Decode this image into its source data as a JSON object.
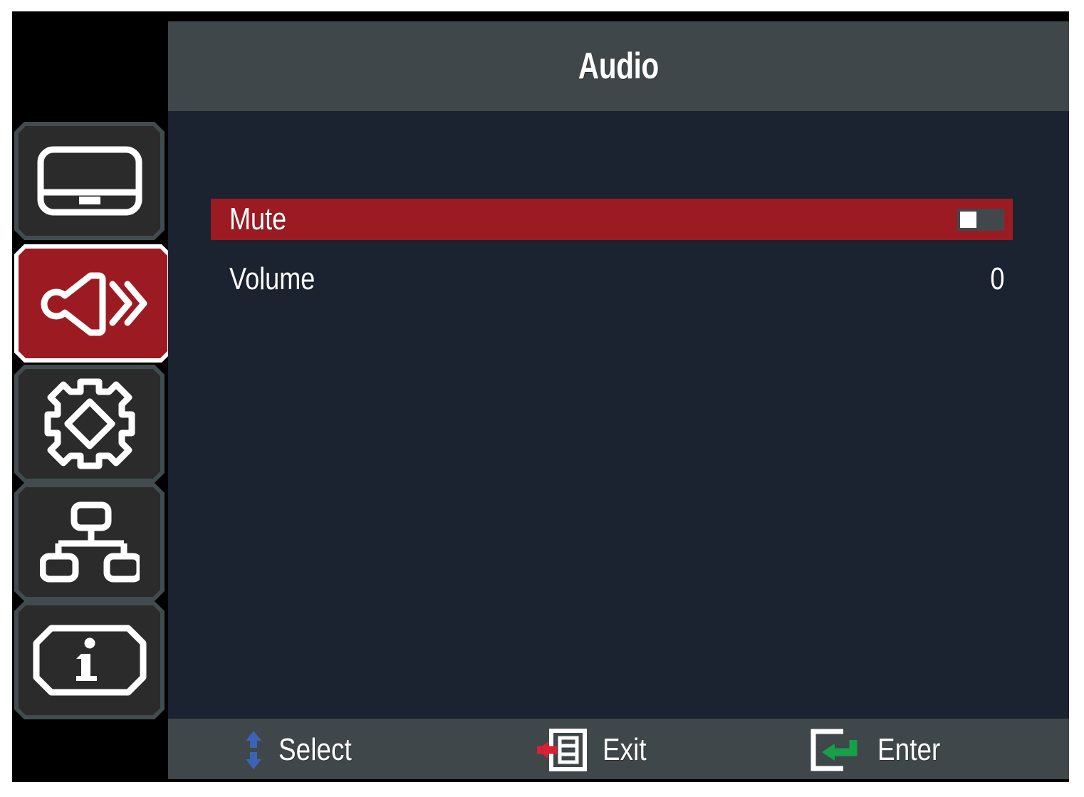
{
  "colors": {
    "frame": "#000000",
    "header_bg": "#3f474a",
    "body_bg": "#1b2330",
    "footer_bg": "#3f474a",
    "accent_red": "#9c1b22",
    "tile_bg": "#2b2b2b",
    "tile_border": "#414c4f",
    "selected_border": "#ffffff",
    "text": "#ffffff",
    "select_arrow_blue": "#3b63b8",
    "exit_arrow_red": "#d92231",
    "enter_arrow_green": "#17a04a"
  },
  "header": {
    "title": "Audio"
  },
  "sidebar": {
    "items": [
      {
        "icon": "display-monitor-icon",
        "name": "sidebar-item-display",
        "selected": false
      },
      {
        "icon": "audio-speaker-icon",
        "name": "sidebar-item-audio",
        "selected": true
      },
      {
        "icon": "settings-gear-icon",
        "name": "sidebar-item-settings",
        "selected": false
      },
      {
        "icon": "network-hierarchy-icon",
        "name": "sidebar-item-network",
        "selected": false
      },
      {
        "icon": "information-icon",
        "name": "sidebar-item-information",
        "selected": false
      }
    ]
  },
  "main": {
    "rows": [
      {
        "label": "Mute",
        "control": "toggle",
        "toggle_state": "off",
        "value": "",
        "highlighted": true
      },
      {
        "label": "Volume",
        "control": "value",
        "value": "0",
        "highlighted": false
      }
    ]
  },
  "footer": {
    "hints": [
      {
        "icon": "up-down-arrow-icon",
        "label": "Select"
      },
      {
        "icon": "exit-arrow-icon",
        "label": "Exit"
      },
      {
        "icon": "enter-arrow-icon",
        "label": "Enter"
      }
    ]
  }
}
